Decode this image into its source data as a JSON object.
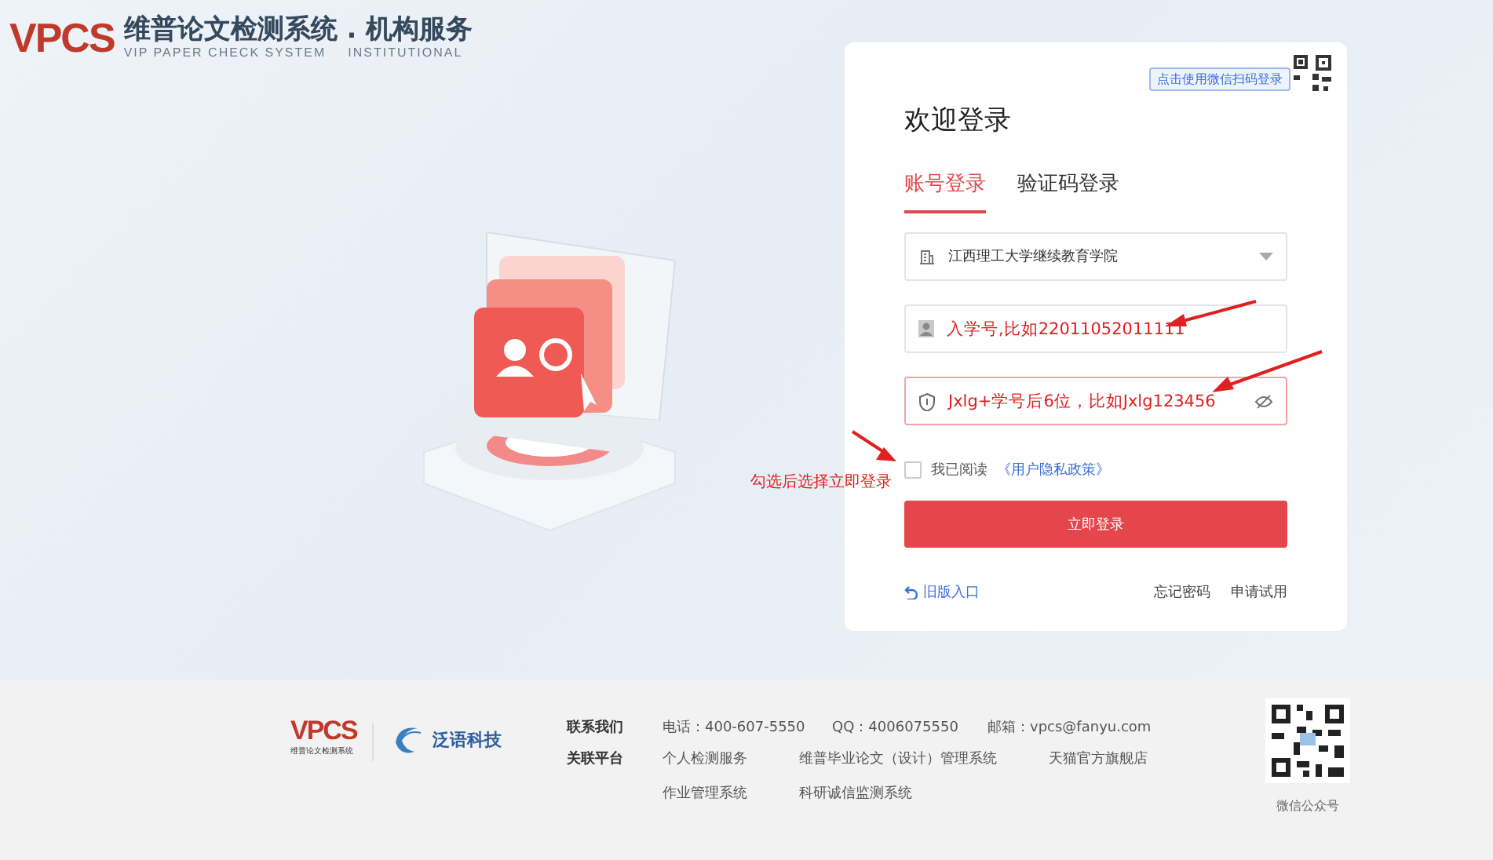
{
  "header": {
    "logo": "VPCS",
    "title": "维普论文检测系统 . 机构服务",
    "subtitle": "VIP PAPER CHECK SYSTEM",
    "subtitle_2": "INSTITUTIONAL"
  },
  "login": {
    "qr_tip": "点击使用微信扫码登录",
    "heading": "欢迎登录",
    "tabs": [
      {
        "label": "账号登录",
        "selected": true
      },
      {
        "label": "验证码登录",
        "selected": false
      }
    ],
    "institution": {
      "value": "江西理工大学继续教育学院"
    },
    "account": {
      "value": "入学号,比如22011052011111"
    },
    "password": {
      "value": "Jxlg+学号后6位，比如Jxlg123456",
      "error": true
    },
    "agree": {
      "label": "我已阅读",
      "link": "《用户隐私政策》",
      "checked": false
    },
    "submit": "立即登录",
    "old_entry": "旧版入口",
    "links": [
      "忘记密码",
      "申请试用"
    ]
  },
  "annotation": "勾选后选择立即登录",
  "footer": {
    "logo": "VPCS",
    "logo_caption": "维普论文检测系统",
    "partner": "泛语科技",
    "contact_label": "联系我们",
    "contacts": [
      "电话：400-607-5550",
      "QQ：4006075550",
      "邮箱：vpcs@fanyu.com"
    ],
    "platform_label": "关联平台",
    "platforms": [
      "个人检测服务",
      "维普毕业论文（设计）管理系统",
      "天猫官方旗舰店",
      "作业管理系统",
      "科研诚信监测系统"
    ],
    "qr_caption": "微信公众号"
  }
}
